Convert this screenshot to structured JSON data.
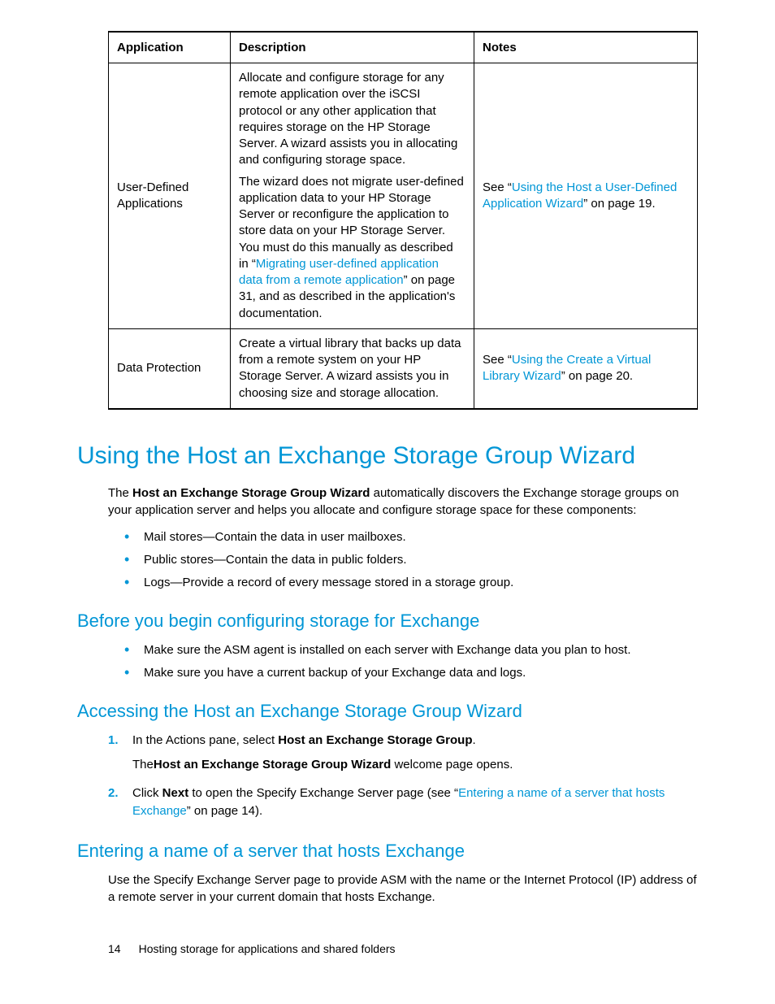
{
  "table": {
    "headers": [
      "Application",
      "Description",
      "Notes"
    ],
    "rows": [
      {
        "app": "User-Defined Applications",
        "desc_p1": "Allocate and configure storage for any remote application over the iSCSI protocol or any other application that requires storage on the HP Storage Server. A wizard assists you in allocating and configuring storage space.",
        "desc_p2_pre": "The wizard does not migrate user-defined application data to your HP Storage Server or reconfigure the application to store data on your HP Storage Server. You must do this manually as described in “",
        "desc_p2_link": "Migrating user-defined application data from a remote application",
        "desc_p2_post": "” on page 31, and as described in the application's documentation.",
        "notes_pre": "See “",
        "notes_link": "Using the Host a User-Defined Application Wizard",
        "notes_post": "” on page 19."
      },
      {
        "app": "Data Protection",
        "desc_p1": "Create a virtual library that backs up data from a remote system on your HP Storage Server. A wizard assists you in choosing size and storage allocation.",
        "notes_pre": "See “",
        "notes_link": "Using the Create a Virtual Library Wizard",
        "notes_post": "” on page 20."
      }
    ]
  },
  "h1": "Using the Host an Exchange Storage Group Wizard",
  "intro_pre": "The ",
  "intro_bold": "Host an Exchange Storage Group Wizard",
  "intro_post": " automatically discovers the Exchange storage groups on your application server and helps you allocate and configure storage space for these components:",
  "bullets_intro": [
    "Mail stores—Contain the data in user mailboxes.",
    "Public stores—Contain the data in public folders.",
    "Logs—Provide a record of every message stored in a storage group."
  ],
  "h2a": "Before you begin configuring storage for Exchange",
  "bullets_before": [
    "Make sure the ASM agent is installed on each server with Exchange data you plan to host.",
    "Make sure you have a current backup of your Exchange data and logs."
  ],
  "h2b": "Accessing the Host an Exchange Storage Group Wizard",
  "step1_pre": "In the Actions pane, select ",
  "step1_bold": "Host an Exchange Storage Group",
  "step1_post": ".",
  "step1_sub_pre": "The",
  "step1_sub_bold": "Host an Exchange Storage Group Wizard",
  "step1_sub_post": " welcome page opens.",
  "step2_pre": "Click ",
  "step2_bold": "Next",
  "step2_mid": " to open the Specify Exchange Server page (see “",
  "step2_link": "Entering a name of a server that hosts Exchange",
  "step2_post": "” on page 14).",
  "h2c": "Entering a name of a server that hosts Exchange",
  "para_c": "Use the Specify Exchange Server page to provide ASM with the name or the Internet Protocol (IP) address of a remote server in your current domain that hosts Exchange.",
  "footer_page": "14",
  "footer_text": "Hosting storage for applications and shared folders"
}
